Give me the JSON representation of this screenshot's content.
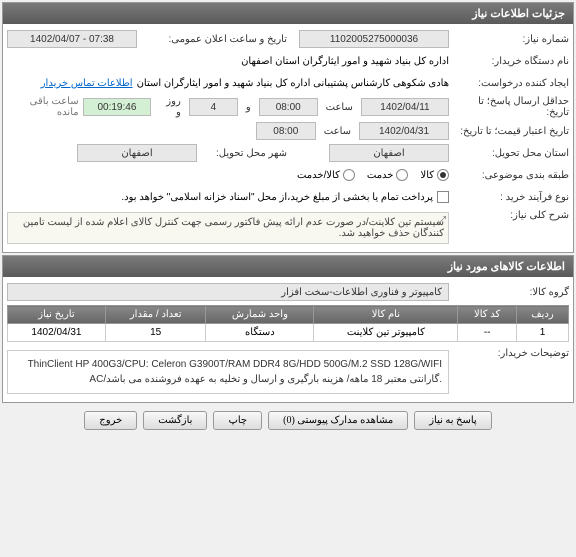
{
  "panel1": {
    "title": "جزئیات اطلاعات نیاز"
  },
  "fields": {
    "need_number_label": "شماره نیاز:",
    "need_number": "1102005275000036",
    "announce_datetime_label": "تاریخ و ساعت اعلان عمومی:",
    "announce_datetime": "1402/04/07 - 07:38",
    "buyer_name_label": "نام دستگاه خریدار:",
    "buyer_name": "اداره کل بنیاد شهید و امور ایثارگران استان اصفهان",
    "request_creator_label": "ایجاد کننده درخواست:",
    "request_creator": "هادی شکوهی کارشناس پشتیبانی اداره کل بنیاد شهید و امور ایثارگران استان",
    "buyer_contact_label": "اطلاعات تماس خریدار",
    "response_deadline_label": "حداقل ارسال پاسخ؛ تا تاریخ:",
    "response_deadline_date": "1402/04/11",
    "response_hour_label": "ساعت",
    "response_hour": "08:00",
    "and_label": "و",
    "days_label": "روز و",
    "days": "4",
    "remaining_time": "00:19:46",
    "remaining_label": "ساعت باقی مانده",
    "price_validity_label": "تاریخ اعتبار قیمت؛ تا تاریخ:",
    "price_validity_date": "1402/04/31",
    "price_validity_hour": "08:00",
    "city_label": "شهر محل تحویل:",
    "city": "اصفهان",
    "province_label": "استان محل تحویل:",
    "province": "اصفهان",
    "topic_label": "طبقه بندی موضوعی:",
    "topic_goods": "کالا",
    "topic_service": "خدمت",
    "topic_goods_service": "کالا/خدمت",
    "purchase_type_label": "نوع فرآیند خرید :",
    "purchase_type_text": "پرداخت تمام یا بخشی از مبلغ خرید،از محل \"اسناد خزانه اسلامی\" خواهد بود.",
    "summary_label": "شرح کلی نیاز:",
    "summary_text": "سیستم تین کلاینت/در صورت عدم ارائه پیش فاکتور رسمی جهت کنترل کالای اعلام شده از لیست تامین کنندگان حذف خواهید شد.",
    "goods_info_title": "اطلاعات کالاهای مورد نیاز",
    "goods_group_label": "گروه کالا:",
    "goods_group": "کامپیوتر و فناوری اطلاعات-سخت افزار",
    "buyer_desc_label": "توضیحات خریدار:",
    "buyer_desc": "ThinClient HP 400G3/CPU: Celeron G3900T/RAM DDR4 8G/HDD 500G/M.2 SSD 128G/WIFI AC/گارانتی معتبر 18 ماهه/ هزینه بارگیری و ارسال و تخلیه به عهده فروشنده می باشد."
  },
  "table": {
    "headers": {
      "row": "ردیف",
      "code": "کد کالا",
      "name": "نام کالا",
      "unit": "واحد شمارش",
      "qty": "تعداد / مقدار",
      "date": "تاریخ نیاز"
    },
    "rows": [
      {
        "row": "1",
        "code": "--",
        "name": "کامپیوتر تین کلاینت",
        "unit": "دستگاه",
        "qty": "15",
        "date": "1402/04/31"
      }
    ]
  },
  "buttons": {
    "respond": "پاسخ به نیاز",
    "view_docs": "مشاهده مدارک پیوستی (0)",
    "print": "چاپ",
    "back": "بازگشت",
    "exit": "خروج"
  }
}
